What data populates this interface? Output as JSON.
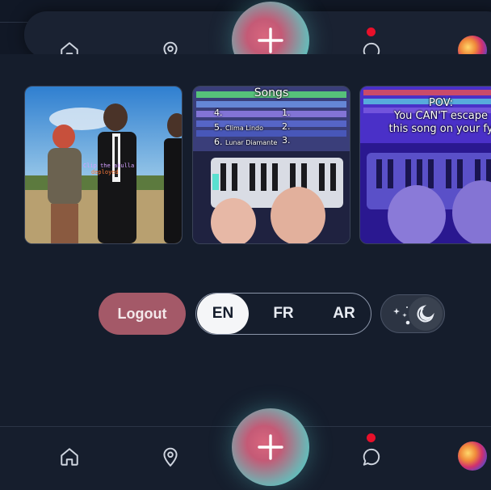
{
  "top_nav": {
    "items": [
      {
        "icon": "home-icon"
      },
      {
        "icon": "location-pin-icon"
      },
      {
        "icon": "plus-icon"
      },
      {
        "icon": "chat-icon",
        "has_notification": true
      },
      {
        "icon": "avatar"
      }
    ]
  },
  "thumbnails": [
    {
      "caption_line1": "Clip the akulla",
      "caption_line2": "deployed"
    },
    {
      "title": "Songs",
      "lines": [
        {
          "num": "4.",
          "text": "",
          "num2": "1."
        },
        {
          "num": "5.",
          "text": "Clima Lindo",
          "num2": "2."
        },
        {
          "num": "6.",
          "text": "Lunar Diamante",
          "num2": "3."
        }
      ]
    },
    {
      "title": "POV:",
      "line1": "You CAN'T escape",
      "line2": "this song on your fy"
    }
  ],
  "controls": {
    "logout_label": "Logout",
    "languages": [
      "EN",
      "FR",
      "AR"
    ],
    "active_language": "EN",
    "theme": "dark"
  },
  "bottom_nav": {
    "items": [
      {
        "icon": "home-icon"
      },
      {
        "icon": "location-pin-icon"
      },
      {
        "icon": "plus-icon"
      },
      {
        "icon": "chat-icon",
        "has_notification": true
      },
      {
        "icon": "avatar"
      }
    ]
  },
  "colors": {
    "background": "#151d2c",
    "logout": "#a45968",
    "notification": "#e8102a"
  }
}
